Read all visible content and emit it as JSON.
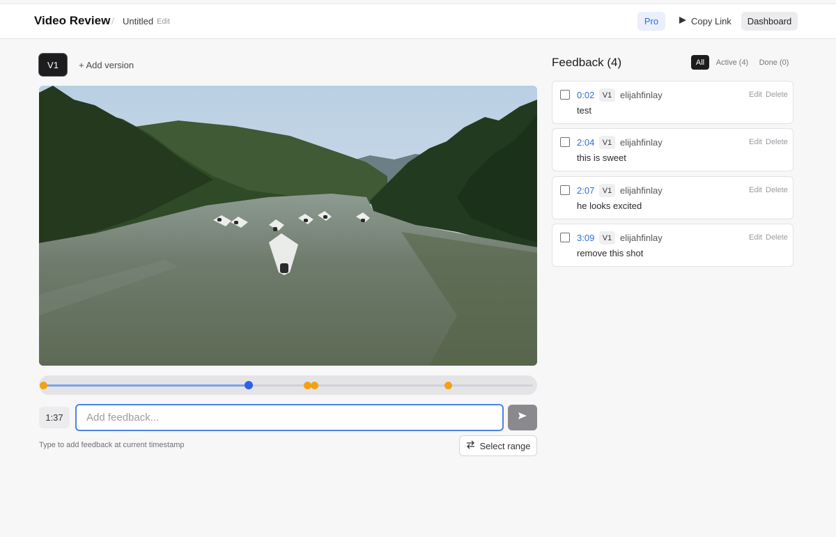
{
  "header": {
    "title": "Video Review",
    "separator": "/",
    "project_name": "Untitled",
    "edit_label": "Edit",
    "pro_label": "Pro",
    "copy_link_label": "Copy Link",
    "dashboard_label": "Dashboard"
  },
  "versions": {
    "current": "V1",
    "add_label": "+ Add version"
  },
  "player": {
    "current_time": "1:37",
    "progress_fraction": 0.42,
    "markers": [
      "0:02",
      "2:04",
      "2:07",
      "3:09"
    ],
    "feedback_placeholder": "Add feedback...",
    "hint": "Type to add feedback at current timestamp",
    "select_range_label": "Select range"
  },
  "feedback": {
    "title": "Feedback (4)",
    "filters": [
      {
        "label": "All",
        "active": true
      },
      {
        "label": "Active (4)",
        "active": false
      },
      {
        "label": "Done (0)",
        "active": false
      }
    ],
    "edit_label": "Edit",
    "delete_label": "Delete",
    "items": [
      {
        "time": "0:02",
        "version": "V1",
        "author": "elijahfinlay",
        "text": "test"
      },
      {
        "time": "2:04",
        "version": "V1",
        "author": "elijahfinlay",
        "text": "this is sweet"
      },
      {
        "time": "2:07",
        "version": "V1",
        "author": "elijahfinlay",
        "text": "he looks excited"
      },
      {
        "time": "3:09",
        "version": "V1",
        "author": "elijahfinlay",
        "text": "remove this shot"
      }
    ]
  },
  "colors": {
    "accent": "#2f6fd6",
    "marker": "#f2a114",
    "playhead": "#2f62e0",
    "dark": "#1d1d1f"
  }
}
